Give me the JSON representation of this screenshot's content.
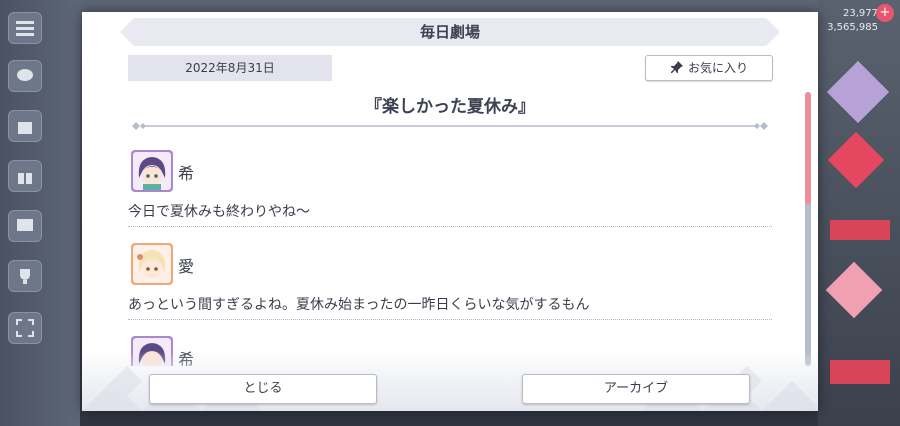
{
  "background": {
    "counters": [
      "23,977",
      "3,565,985"
    ],
    "plus": "+"
  },
  "dialog": {
    "title": "毎日劇場",
    "date": "2022年8月31日",
    "favorite_label": "お気に入り",
    "story_title": "『楽しかった夏休み』",
    "entries": [
      {
        "speaker": "希",
        "text": "今日で夏休みも終わりやね～"
      },
      {
        "speaker": "愛",
        "text": "あっという間すぎるよね。夏休み始まったの一昨日くらいな気がするもん"
      },
      {
        "speaker": "希",
        "text": ""
      }
    ],
    "close_label": "とじる",
    "archive_label": "アーカイブ"
  },
  "colors": {
    "accent_scroll": "#ef8c99",
    "title_bar": "#e9eaf1",
    "text": "#3a3e4c"
  }
}
